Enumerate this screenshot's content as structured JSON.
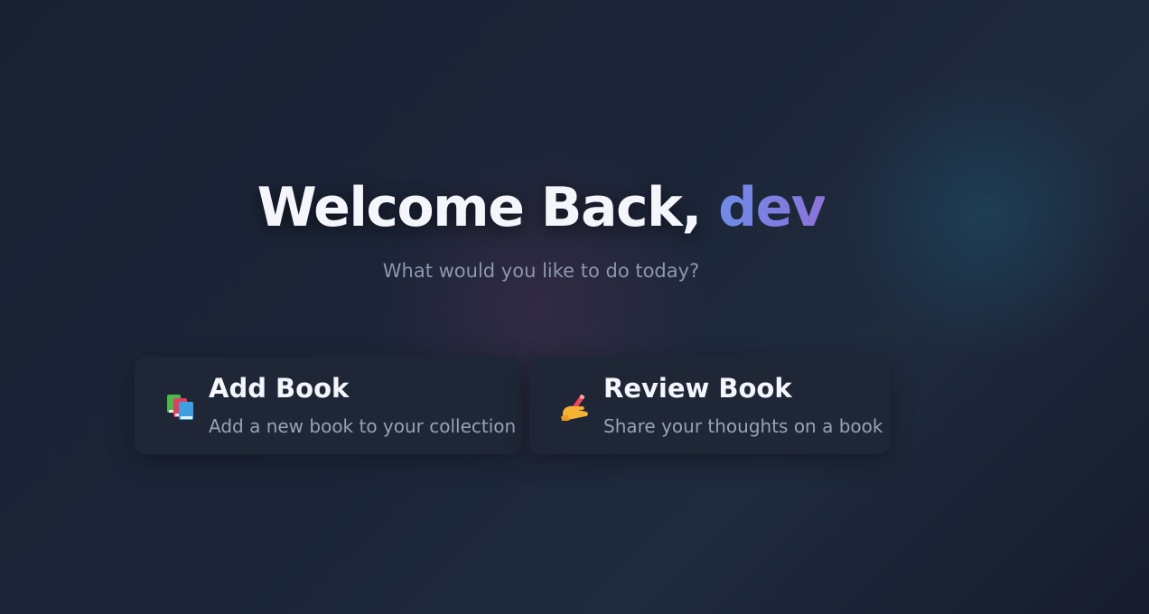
{
  "welcome": {
    "greeting": "Welcome Back,",
    "username": "dev",
    "subtitle": "What would you like to do today?"
  },
  "actions": [
    {
      "title": "Add Book",
      "description": "Add a new book to your collection",
      "icon": "books-icon"
    },
    {
      "title": "Review Book",
      "description": "Share your thoughts on a book",
      "icon": "writing-hand-icon"
    }
  ],
  "colors": {
    "background": "#1c2538",
    "card": "#1f2737",
    "title_text": "#f4f6fb",
    "muted_text": "#8b98ad",
    "username_gradient_start": "#6f8ce8",
    "username_gradient_end": "#8b73d9"
  }
}
